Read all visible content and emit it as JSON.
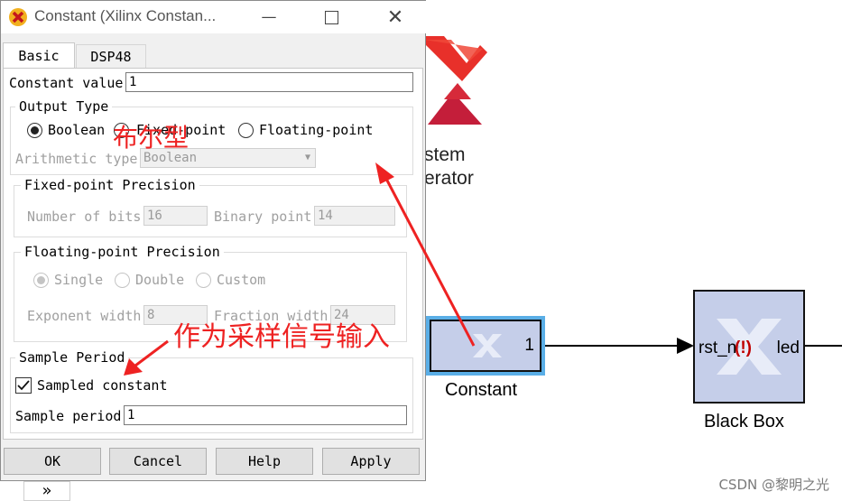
{
  "dialog": {
    "title": "Constant (Xilinx Constan...",
    "tabs": [
      "Basic",
      "DSP48"
    ],
    "constant_value_label": "Constant value",
    "constant_value": "1",
    "output_type": {
      "legend": "Output Type",
      "options": [
        "Boolean",
        "Fixed-point",
        "Floating-point"
      ],
      "selected": "Boolean"
    },
    "arithmetic_type_label": "Arithmetic type",
    "arithmetic_type_value": "Boolean",
    "fixed_point": {
      "legend": "Fixed-point Precision",
      "bits_label": "Number of bits",
      "bits_value": "16",
      "binary_point_label": "Binary point",
      "binary_point_value": "14"
    },
    "floating_point": {
      "legend": "Floating-point Precision",
      "options": [
        "Single",
        "Double",
        "Custom"
      ],
      "exponent_label": "Exponent width",
      "exponent_value": "8",
      "fraction_label": "Fraction width",
      "fraction_value": "24"
    },
    "sample_period": {
      "legend": "Sample Period",
      "checkbox_label": "Sampled constant",
      "checked": true,
      "period_label": "Sample period",
      "period_value": "1"
    },
    "buttons": [
      "OK",
      "Cancel",
      "Help",
      "Apply"
    ]
  },
  "canvas": {
    "sysgen_line1": "stem",
    "sysgen_line2": "erator",
    "constant_block": {
      "port_value": "1",
      "label": "Constant"
    },
    "blackbox": {
      "port_in": "rst_n",
      "port_out": "led",
      "error_marker": "(!)",
      "label": "Black Box"
    },
    "expand_glyph": "»"
  },
  "annotations": {
    "boolean_note": "布尔型",
    "sample_note": "作为采样信号输入"
  },
  "watermark": "CSDN @黎明之光",
  "colors": {
    "xilinx_red": "#e8302a",
    "block_blue": "#c5cee9",
    "highlight_blue": "#5aaee6",
    "annotation_red": "#ee2222"
  }
}
